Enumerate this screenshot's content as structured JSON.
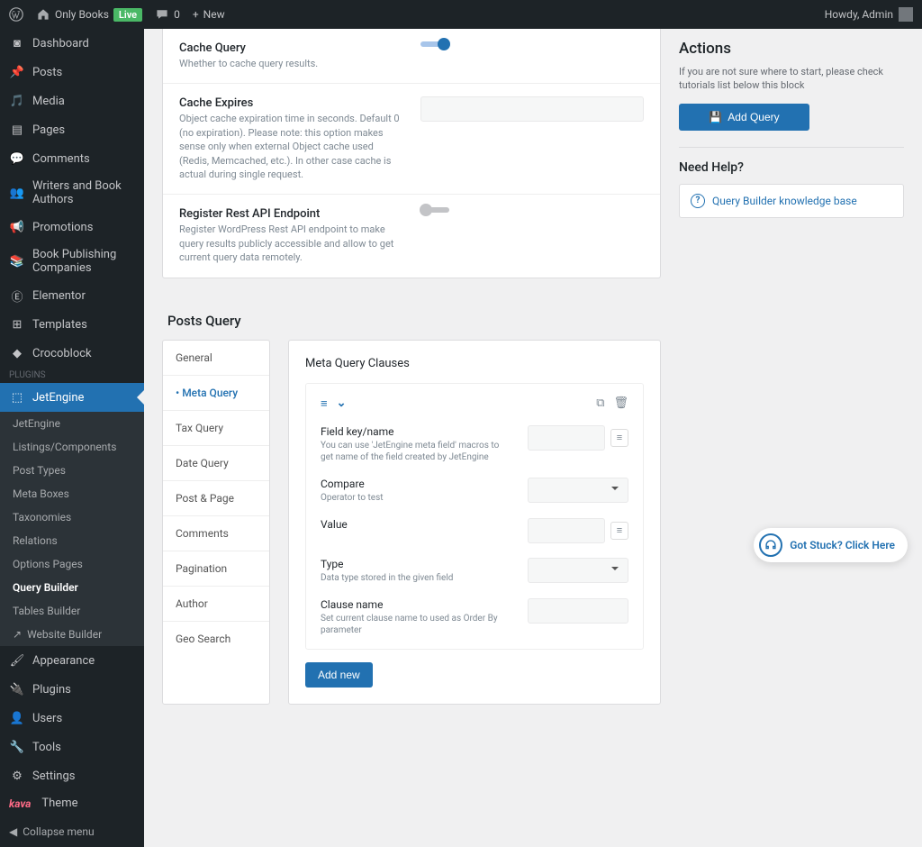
{
  "topbar": {
    "site_name": "Only Books",
    "live_badge": "Live",
    "comments_count": "0",
    "new_label": "New",
    "howdy": "Howdy, Admin"
  },
  "sidebar": {
    "items": [
      {
        "icon": "dashboard",
        "label": "Dashboard"
      },
      {
        "icon": "pin",
        "label": "Posts"
      },
      {
        "icon": "media",
        "label": "Media"
      },
      {
        "icon": "page",
        "label": "Pages"
      },
      {
        "icon": "comment",
        "label": "Comments"
      },
      {
        "icon": "users",
        "label": "Writers and Book Authors"
      },
      {
        "icon": "megaphone",
        "label": "Promotions"
      },
      {
        "icon": "book",
        "label": "Book Publishing Companies"
      },
      {
        "icon": "elementor",
        "label": "Elementor"
      },
      {
        "icon": "template",
        "label": "Templates"
      },
      {
        "icon": "croco",
        "label": "Crocoblock"
      }
    ],
    "active": {
      "icon": "api",
      "label": "JetEngine"
    },
    "submenu": [
      "JetEngine",
      "Listings/Components",
      "Post Types",
      "Meta Boxes",
      "Taxonomies",
      "Relations",
      "Options Pages",
      "Query Builder",
      "Tables Builder",
      "Website Builder"
    ],
    "active_sub": "Query Builder",
    "items2": [
      {
        "icon": "brush",
        "label": "Appearance"
      },
      {
        "icon": "plugin",
        "label": "Plugins"
      },
      {
        "icon": "user",
        "label": "Users"
      },
      {
        "icon": "tools",
        "label": "Tools"
      },
      {
        "icon": "settings",
        "label": "Settings"
      }
    ],
    "theme_brand": "kava",
    "theme_label": "Theme",
    "collapse": "Collapse menu"
  },
  "settings": {
    "cache_query": {
      "title": "Cache Query",
      "desc": "Whether to cache query results."
    },
    "cache_expires": {
      "title": "Cache Expires",
      "desc": "Object cache expiration time in seconds. Default 0 (no expiration). Please note: this option makes sense only when external Object cache used (Redis, Memcached, etc.). In other case cache is actual during single request."
    },
    "rest_api": {
      "title": "Register Rest API Endpoint",
      "desc": "Register WordPress Rest API endpoint to make query results publicly accessible and allow to get current query data remotely."
    }
  },
  "posts_query": {
    "heading": "Posts Query",
    "tabs": [
      "General",
      "Meta Query",
      "Tax Query",
      "Date Query",
      "Post & Page",
      "Comments",
      "Pagination",
      "Author",
      "Geo Search"
    ],
    "active_tab": "Meta Query",
    "panel_title": "Meta Query Clauses",
    "fields": {
      "field_key": {
        "t": "Field key/name",
        "d": "You can use 'JetEngine meta field' macros to get name of the field created by JetEngine"
      },
      "compare": {
        "t": "Compare",
        "d": "Operator to test"
      },
      "value": {
        "t": "Value",
        "d": ""
      },
      "type": {
        "t": "Type",
        "d": "Data type stored in the given field"
      },
      "clause_name": {
        "t": "Clause name",
        "d": "Set current clause name to used as Order By parameter"
      }
    },
    "add_new": "Add new"
  },
  "aside": {
    "actions_h": "Actions",
    "actions_desc": "If you are not sure where to start, please check tutorials list below this block",
    "add_query_btn": "Add Query",
    "help_h": "Need Help?",
    "kb_link": "Query Builder knowledge base"
  },
  "help_widget": "Got Stuck? Click Here"
}
